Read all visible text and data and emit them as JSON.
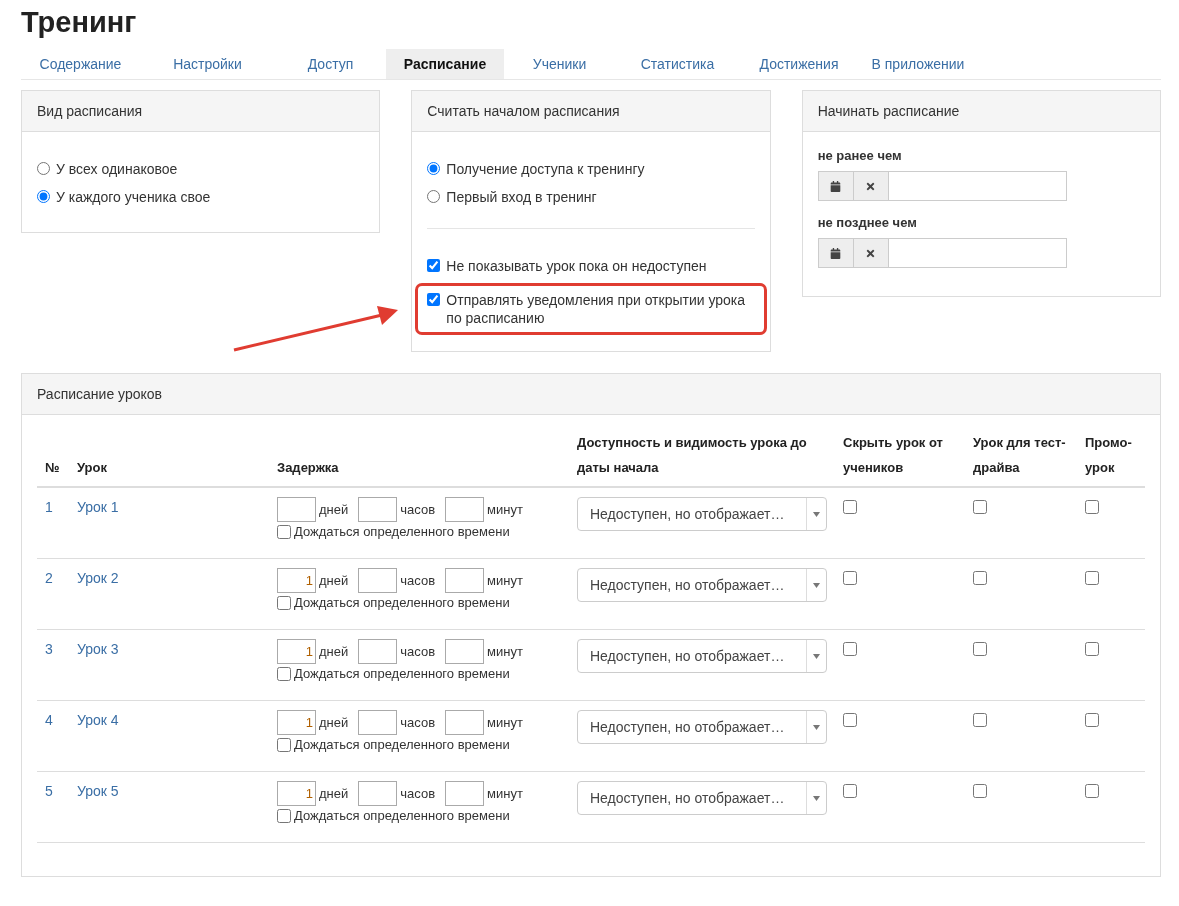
{
  "title": "Тренинг",
  "tabs": [
    {
      "label": "Содержание",
      "selected": false
    },
    {
      "label": "Настройки",
      "selected": false
    },
    {
      "label": "Доступ",
      "selected": false
    },
    {
      "label": "Расписание",
      "selected": true
    },
    {
      "label": "Ученики",
      "selected": false
    },
    {
      "label": "Статистика",
      "selected": false
    },
    {
      "label": "Достижения",
      "selected": false
    },
    {
      "label": "В приложении",
      "selected": false
    }
  ],
  "schedule_type": {
    "title": "Вид расписания",
    "options": [
      {
        "label": "У всех одинаковое",
        "selected": false
      },
      {
        "label": "У каждого ученика свое",
        "selected": true
      }
    ]
  },
  "schedule_start": {
    "title": "Считать началом расписания",
    "options": [
      {
        "label": "Получение доступа к тренингу",
        "selected": true
      },
      {
        "label": "Первый вход в тренинг",
        "selected": false
      }
    ],
    "checks": [
      {
        "label": "Не показывать урок пока он недоступен",
        "checked": true,
        "highlighted": false
      },
      {
        "label": "Отправлять уведомления при открытии урока по расписанию",
        "checked": true,
        "highlighted": true
      }
    ]
  },
  "start_dates": {
    "title": "Начинать расписание",
    "fields": [
      {
        "label": "не ранее чем"
      },
      {
        "label": "не позднее чем"
      }
    ]
  },
  "lessons": {
    "title": "Расписание уроков",
    "columns": [
      "№",
      "Урок",
      "Задержка",
      "Доступность и видимость урока до даты начала",
      "Скрыть урок от учеников",
      "Урок для тест-драйва",
      "Промо-урок"
    ],
    "rows": [
      {
        "number": "1",
        "name": "Урок 1",
        "days": "",
        "days_unit": "дней",
        "hours_unit": "часов",
        "minutes_unit": "минут",
        "wait_label": "Дождаться определенного времени",
        "wait": false,
        "visibility": "Недоступен, но отображает…",
        "hidden": false,
        "test_drive": false,
        "promo": false
      },
      {
        "number": "2",
        "name": "Урок 2",
        "days": "1",
        "days_unit": "дней",
        "hours_unit": "часов",
        "minutes_unit": "минут",
        "wait_label": "Дождаться определенного времени",
        "wait": false,
        "visibility": "Недоступен, но отображает…",
        "hidden": false,
        "test_drive": false,
        "promo": false
      },
      {
        "number": "3",
        "name": "Урок 3",
        "days": "1",
        "days_unit": "дней",
        "hours_unit": "часов",
        "minutes_unit": "минут",
        "wait_label": "Дождаться определенного времени",
        "wait": false,
        "visibility": "Недоступен, но отображает…",
        "hidden": false,
        "test_drive": false,
        "promo": false
      },
      {
        "number": "4",
        "name": "Урок 4",
        "days": "1",
        "days_unit": "дней",
        "hours_unit": "часов",
        "minutes_unit": "минут",
        "wait_label": "Дождаться определенного времени",
        "wait": false,
        "visibility": "Недоступен, но отображает…",
        "hidden": false,
        "test_drive": false,
        "promo": false
      },
      {
        "number": "5",
        "name": "Урок 5",
        "days": "1",
        "days_unit": "дней",
        "hours_unit": "часов",
        "minutes_unit": "минут",
        "wait_label": "Дождаться определенного времени",
        "wait": false,
        "visibility": "Недоступен, но отображает…",
        "hidden": false,
        "test_drive": false,
        "promo": false
      }
    ]
  }
}
